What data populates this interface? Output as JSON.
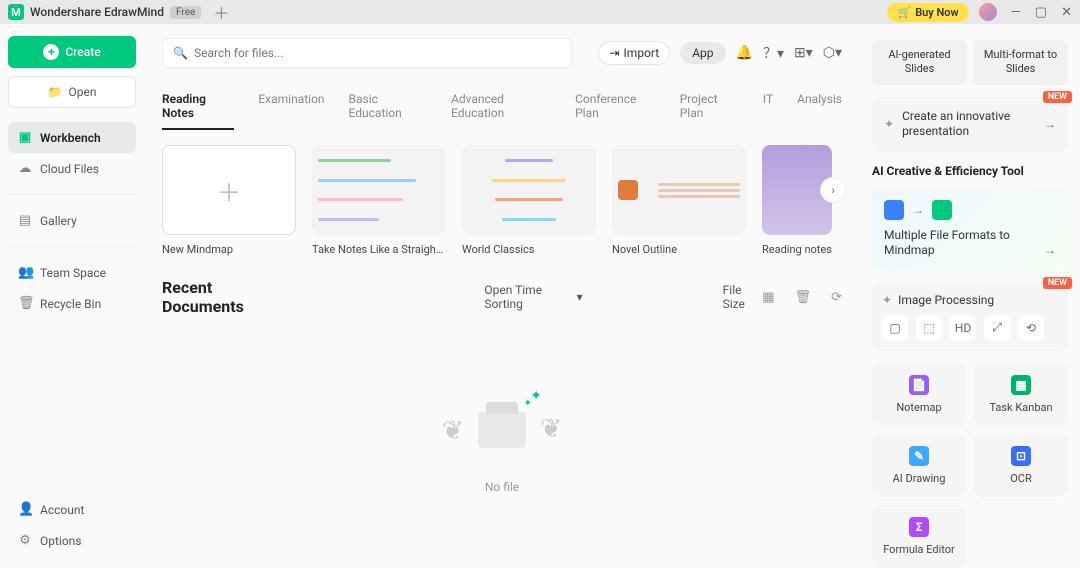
{
  "titlebar": {
    "app_name": "Wondershare EdrawMind",
    "free_badge": "Free",
    "buy_now": "Buy Now"
  },
  "sidebar": {
    "create": "Create",
    "open": "Open",
    "nav": [
      {
        "label": "Workbench"
      },
      {
        "label": "Cloud Files"
      }
    ],
    "nav2": [
      {
        "label": "Gallery"
      }
    ],
    "nav3": [
      {
        "label": "Team Space"
      },
      {
        "label": "Recycle Bin"
      }
    ],
    "bottom": [
      {
        "label": "Account"
      },
      {
        "label": "Options"
      }
    ]
  },
  "topbar": {
    "search_placeholder": "Search for files...",
    "import": "Import",
    "app": "App"
  },
  "tabs": [
    "Reading Notes",
    "Examination",
    "Basic Education",
    "Advanced Education",
    "Conference Plan",
    "Project Plan",
    "IT",
    "Analysis"
  ],
  "templates": [
    {
      "label": "New Mindmap"
    },
    {
      "label": "Take Notes Like a Straight-..."
    },
    {
      "label": "World Classics"
    },
    {
      "label": "Novel Outline"
    },
    {
      "label": "Reading notes"
    }
  ],
  "recent": {
    "title": "Recent Documents",
    "sort": "Open Time Sorting",
    "filesize": "File Size",
    "empty": "No file"
  },
  "rightpane": {
    "split1": "AI-generated Slides",
    "split2": "Multi-format to Slides",
    "ai_presentation": "Create an innovative presentation",
    "section_title": "AI Creative & Efficiency Tool",
    "format_card": "Multiple File Formats to Mindmap",
    "image_processing": "Image Processing",
    "new_badge": "NEW",
    "tools": [
      {
        "label": "Notemap",
        "color": "#9b5cff"
      },
      {
        "label": "Task Kanban",
        "color": "#00b56a"
      },
      {
        "label": "AI Drawing",
        "color": "#3ba9ff"
      },
      {
        "label": "OCR",
        "color": "#3b6bff"
      },
      {
        "label": "Formula Editor",
        "color": "#b14bff"
      }
    ]
  }
}
